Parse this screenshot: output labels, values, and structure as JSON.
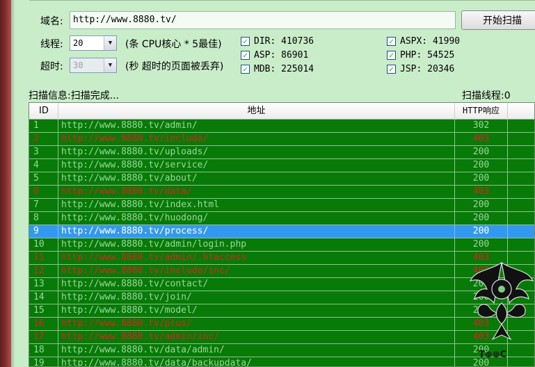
{
  "form": {
    "domain_label": "域名:",
    "domain_value": "http://www.8880.tv/",
    "start_button": "开始扫描",
    "threads_label": "线程:",
    "threads_value": "20",
    "threads_hint": "(条 CPU核心 * 5最佳)",
    "timeout_label": "超时:",
    "timeout_value": "30",
    "timeout_hint": "(秒 超时的页面被丢弃)"
  },
  "dictionaries": [
    {
      "name": "DIR",
      "label": "DIR: 410736",
      "checked": true
    },
    {
      "name": "ASP",
      "label": "ASP: 86901",
      "checked": true
    },
    {
      "name": "MDB",
      "label": "MDB: 225014",
      "checked": true
    },
    {
      "name": "ASPX",
      "label": "ASPX: 41990",
      "checked": true
    },
    {
      "name": "PHP",
      "label": "PHP: 54525",
      "checked": true
    },
    {
      "name": "JSP",
      "label": "JSP: 20346",
      "checked": true
    }
  ],
  "status": {
    "info": "扫描信息:扫描完成...",
    "threads": "扫描线程:0"
  },
  "table": {
    "columns": [
      "ID",
      "地址",
      "HTTP响应"
    ],
    "rows": [
      {
        "id": "1",
        "url": "http://www.8880.tv/admin/",
        "code": "302",
        "state": "ok"
      },
      {
        "id": "2",
        "url": "http://www.8880.tv/include/",
        "code": "403",
        "state": "forbidden"
      },
      {
        "id": "3",
        "url": "http://www.8880.tv/uploads/",
        "code": "200",
        "state": "ok"
      },
      {
        "id": "4",
        "url": "http://www.8880.tv/service/",
        "code": "200",
        "state": "ok"
      },
      {
        "id": "5",
        "url": "http://www.8880.tv/about/",
        "code": "200",
        "state": "ok"
      },
      {
        "id": "6",
        "url": "http://www.8880.tv/data/",
        "code": "403",
        "state": "forbidden"
      },
      {
        "id": "7",
        "url": "http://www.8880.tv/index.html",
        "code": "200",
        "state": "ok"
      },
      {
        "id": "8",
        "url": "http://www.8880.tv/huodong/",
        "code": "200",
        "state": "ok"
      },
      {
        "id": "9",
        "url": "http://www.8880.tv/process/",
        "code": "200",
        "state": "selected"
      },
      {
        "id": "10",
        "url": "http://www.8880.tv/admin/login.php",
        "code": "200",
        "state": "ok"
      },
      {
        "id": "11",
        "url": "http://www.8880.tv/admin/.htaccess",
        "code": "403",
        "state": "forbidden"
      },
      {
        "id": "12",
        "url": "http://www.8880.tv/include/inc/",
        "code": "403",
        "state": "forbidden"
      },
      {
        "id": "13",
        "url": "http://www.8880.tv/contact/",
        "code": "200",
        "state": "ok"
      },
      {
        "id": "14",
        "url": "http://www.8880.tv/join/",
        "code": "200",
        "state": "ok"
      },
      {
        "id": "15",
        "url": "http://www.8880.tv/model/",
        "code": "200",
        "state": "ok"
      },
      {
        "id": "16",
        "url": "http://www.8880.tv/plus/",
        "code": "403",
        "state": "forbidden"
      },
      {
        "id": "17",
        "url": "http://www.8880.tv/admin/inc/",
        "code": "403",
        "state": "forbidden"
      },
      {
        "id": "18",
        "url": "http://www.8880.tv/data/admin/",
        "code": "200",
        "state": "ok"
      },
      {
        "id": "19",
        "url": "http://www.8880.tv/data/backupdata/",
        "code": "200",
        "state": "ok"
      }
    ]
  },
  "watermark": {
    "text": "T⊕⊛C"
  },
  "colors": {
    "window_bg": "#c9ecc9",
    "table_bg": "#087a08",
    "ok_text": "#9ad89a",
    "forbidden_text": "#e02020",
    "selected_bg": "#3399f0"
  }
}
